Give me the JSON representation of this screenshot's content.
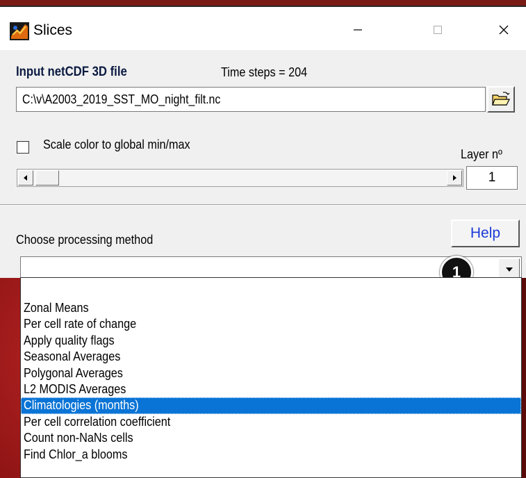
{
  "window": {
    "title": "Slices"
  },
  "file_section": {
    "label": "Input netCDF 3D file",
    "time_steps": "Time steps = 204",
    "file_path": "C:\\v\\A2003_2019_SST_MO_night_filt.nc"
  },
  "options": {
    "scale_checkbox_label": "Scale color to global min/max",
    "scale_checked": false,
    "layer_label": "Layer nº",
    "layer_value": "1"
  },
  "method": {
    "label": "Choose processing method",
    "help_label": "Help",
    "selected_value": "",
    "marker_number": "1"
  },
  "dropdown": {
    "items": [
      "Zonal Means",
      "Per cell rate of change",
      "Apply quality flags",
      "Seasonal Averages",
      "Polygonal Averages",
      "L2 MODIS Averages",
      "Climatologies (months)",
      "Per cell correlation coefficient",
      "Count non-NaNs cells",
      "Find Chlor_a blooms"
    ],
    "highlighted": "Climatologies (months)"
  },
  "colors": {
    "selection": "#0a74d6",
    "help_text": "#1a3ad8",
    "label_bold": "#0a1a40"
  }
}
